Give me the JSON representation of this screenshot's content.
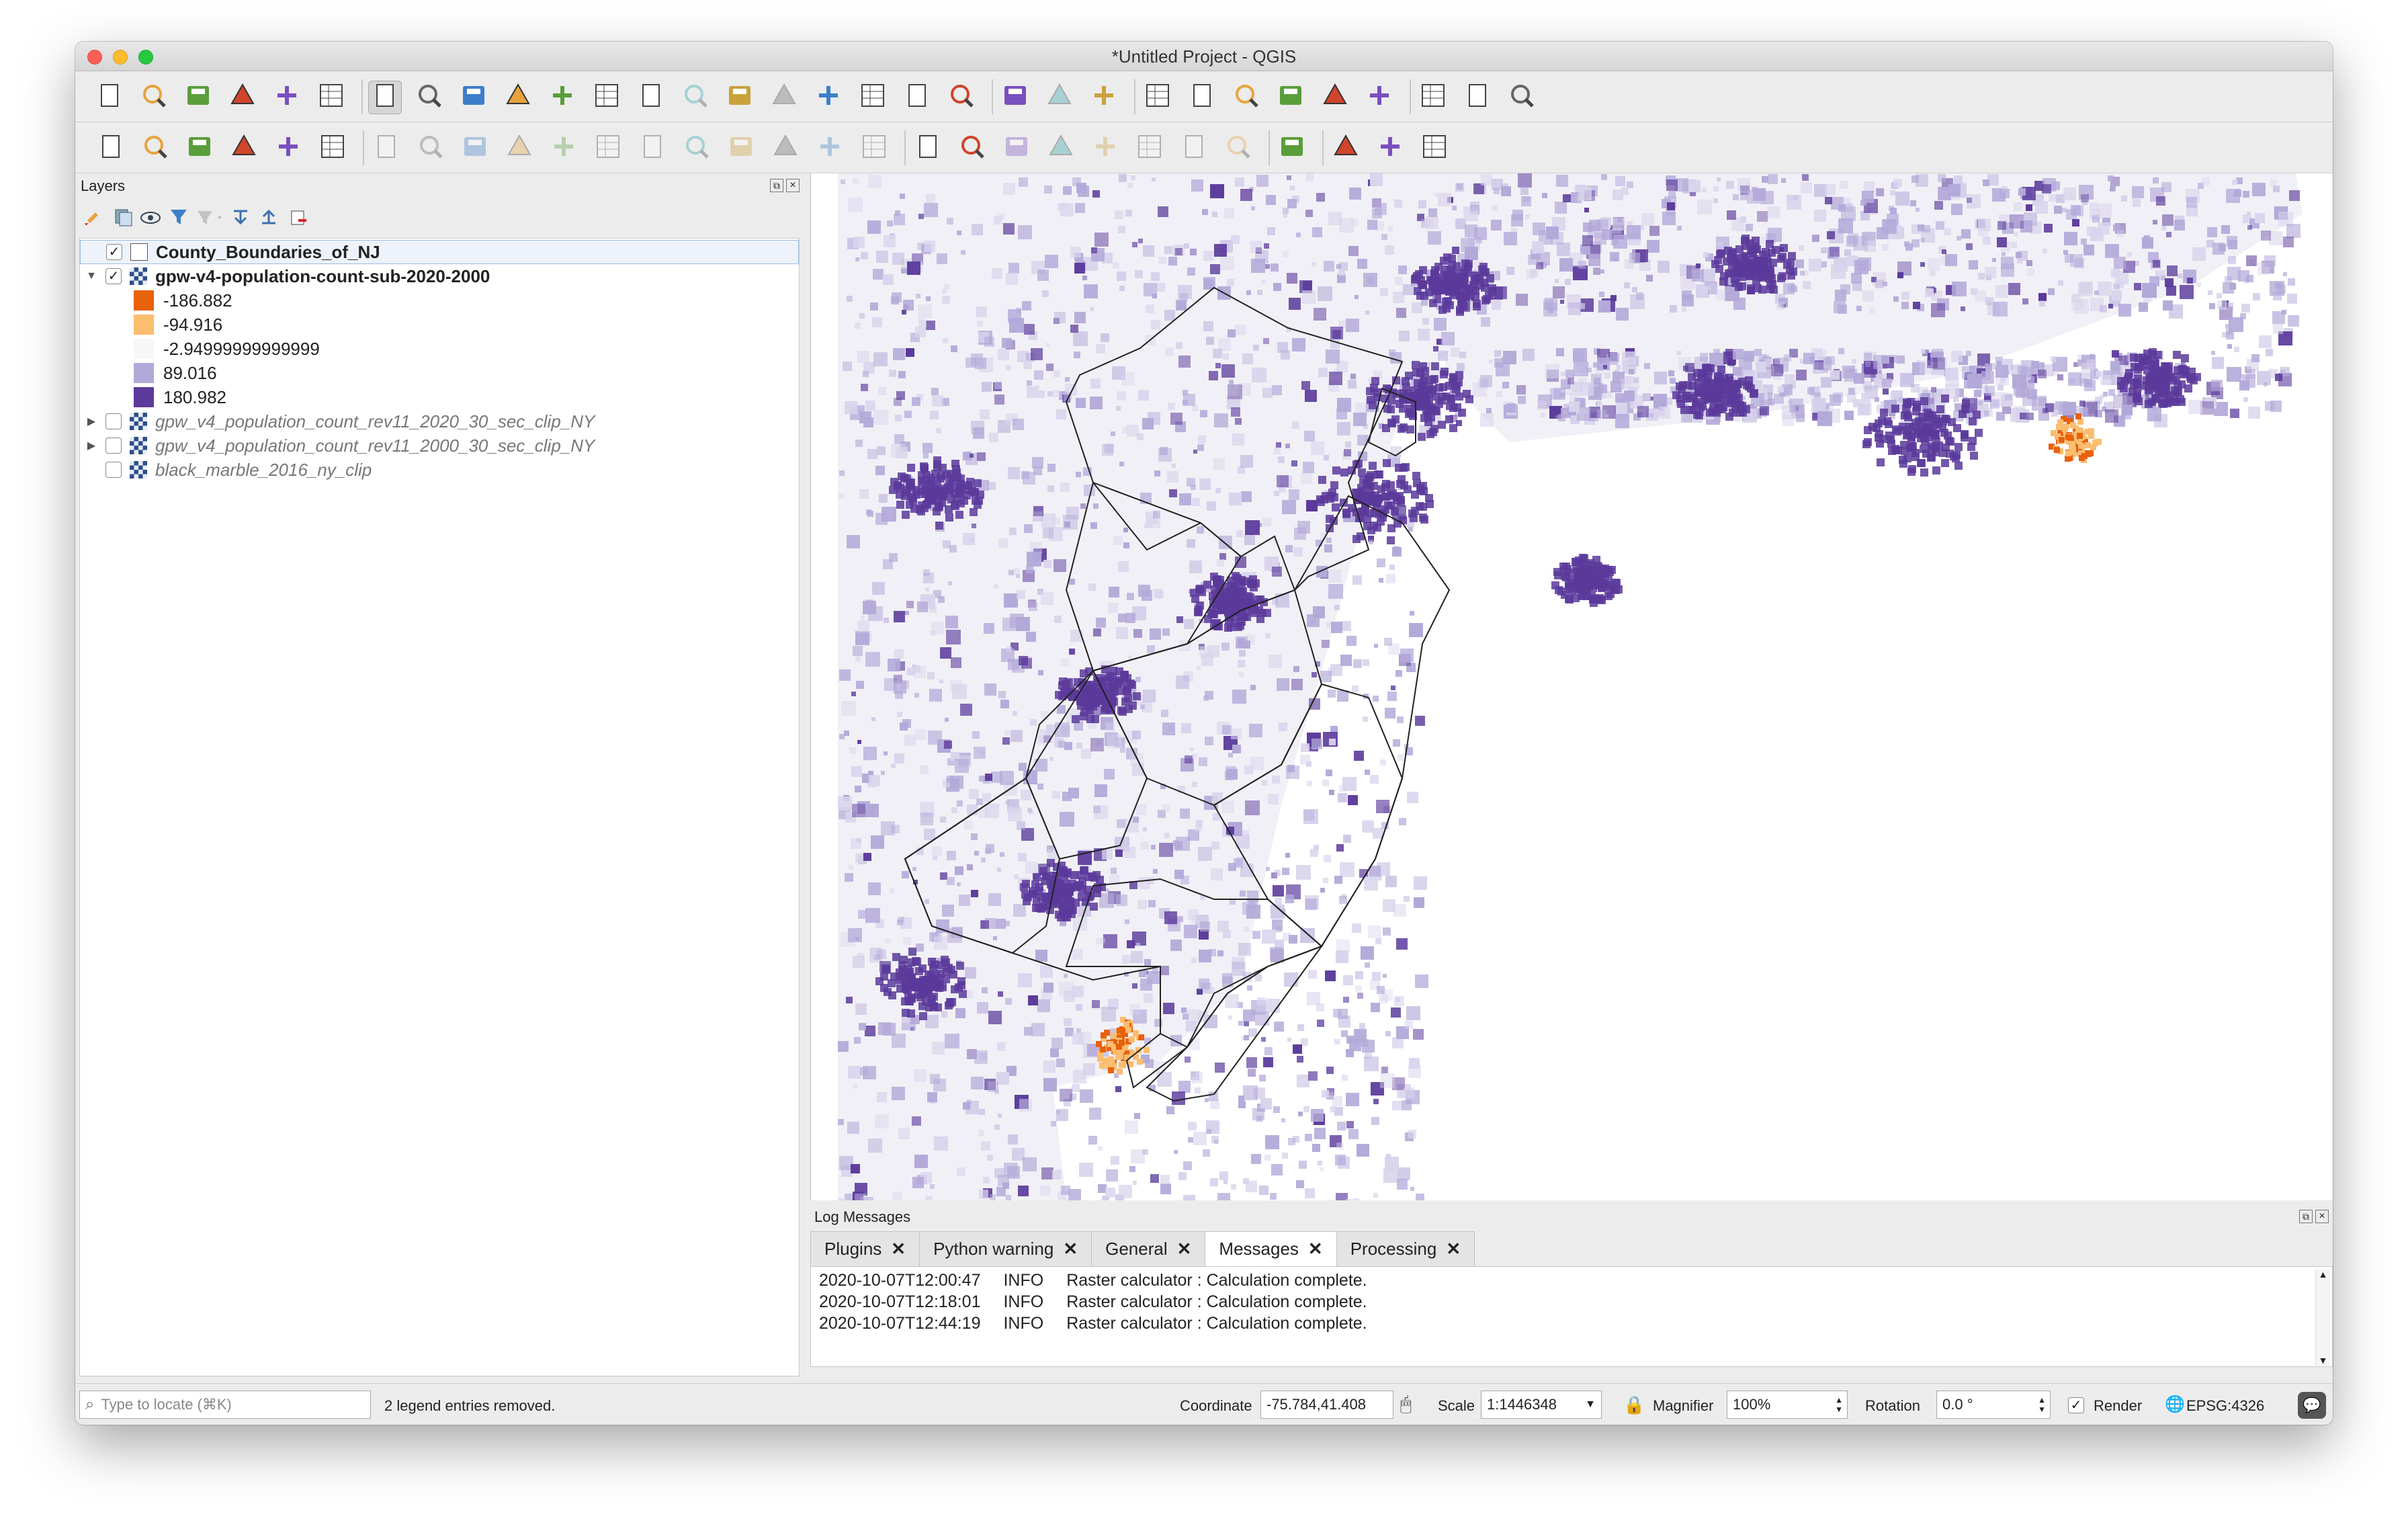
{
  "window": {
    "title": "*Untitled Project - QGIS"
  },
  "colors": {
    "orange_dark": "#e8610d",
    "orange_light": "#fbbd6e",
    "neutral": "#f7f7f7",
    "purple_light": "#b3a9d9",
    "purple_dark": "#5b3a9b"
  },
  "toolbar1": [
    "new-project-icon",
    "open-project-icon",
    "save-project-icon",
    "save-as-icon",
    "project-properties-icon",
    "style-manager-icon",
    "pan-icon",
    "pan-to-selection-icon",
    "zoom-in-icon",
    "zoom-out-icon",
    "zoom-full-icon",
    "zoom-to-selection-icon",
    "zoom-to-layer-icon",
    "zoom-native-icon",
    "zoom-last-icon",
    "zoom-next-icon",
    "new-map-view-icon",
    "new-bookmark-icon",
    "show-bookmarks-icon",
    "refresh-icon",
    "identify-icon",
    "run-action-icon",
    "select-features-icon",
    "open-attribute-table-icon",
    "deselect-icon",
    "attribute-table-icon",
    "field-calculator-icon",
    "processing-toolbox-icon",
    "statistical-summary-icon",
    "measure-icon",
    "map-tips-icon",
    "annotation-icon"
  ],
  "toolbar2": [
    "data-source-manager-icon",
    "new-geopackage-icon",
    "new-shapefile-icon",
    "digitize-icon",
    "new-temp-layer-icon",
    "new-virtual-layer-icon",
    "edits-icon",
    "toggle-editing-icon",
    "save-edits-icon",
    "add-feature-icon",
    "vertex-tool-icon",
    "modify-attributes-icon",
    "delete-selected-icon",
    "cut-features-icon",
    "copy-features-icon",
    "paste-features-icon",
    "undo-icon",
    "redo-icon",
    "label-tool-icon",
    "diagram-icon",
    "pin-label-icon",
    "highlight-label-icon",
    "show-hide-label-icon",
    "move-label-icon",
    "rotate-label-icon",
    "change-label-icon",
    "globe-icon",
    "python-icon",
    "binoculars-icon",
    "help-icon"
  ],
  "layers_panel": {
    "title": "Layers",
    "items": [
      {
        "label": "County_Boundaries_of_NJ",
        "checked": true,
        "style": "bold",
        "type": "vector"
      },
      {
        "label": "gpw-v4-population-count-sub-2020-2000",
        "checked": true,
        "style": "bold",
        "type": "raster",
        "expanded": true
      },
      {
        "label": "gpw_v4_population_count_rev11_2020_30_sec_clip_NY",
        "checked": false,
        "style": "italic",
        "type": "raster",
        "collapsed": true
      },
      {
        "label": "gpw_v4_population_count_rev11_2000_30_sec_clip_NY",
        "checked": false,
        "style": "italic",
        "type": "raster",
        "collapsed": true
      },
      {
        "label": "black_marble_2016_ny_clip",
        "checked": false,
        "style": "italic",
        "type": "raster"
      }
    ],
    "legend": [
      {
        "label": "-186.882",
        "color": "#e8610d"
      },
      {
        "label": "-94.916",
        "color": "#fbbd6e"
      },
      {
        "label": "-2.94999999999999",
        "color": "#f7f7f7"
      },
      {
        "label": "89.016",
        "color": "#b3a9d9"
      },
      {
        "label": "180.982",
        "color": "#5b3a9b"
      }
    ]
  },
  "log_panel": {
    "title": "Log Messages",
    "tabs": [
      {
        "label": "Plugins"
      },
      {
        "label": "Python warning"
      },
      {
        "label": "General"
      },
      {
        "label": "Messages",
        "active": true
      },
      {
        "label": "Processing"
      }
    ],
    "messages": [
      {
        "time": "2020-10-07T12:00:47",
        "level": "INFO",
        "text": "Raster calculator : Calculation complete."
      },
      {
        "time": "2020-10-07T12:18:01",
        "level": "INFO",
        "text": "Raster calculator : Calculation complete."
      },
      {
        "time": "2020-10-07T12:44:19",
        "level": "INFO",
        "text": "Raster calculator : Calculation complete."
      }
    ]
  },
  "statusbar": {
    "locate_placeholder": "Type to locate (⌘K)",
    "message": "2 legend entries removed.",
    "coordinate_label": "Coordinate",
    "coordinate_value": "-75.784,41.408",
    "scale_label": "Scale",
    "scale_value": "1:1446348",
    "magnifier_label": "Magnifier",
    "magnifier_value": "100%",
    "rotation_label": "Rotation",
    "rotation_value": "0.0 °",
    "render_label": "Render",
    "crs": "EPSG:4326"
  }
}
